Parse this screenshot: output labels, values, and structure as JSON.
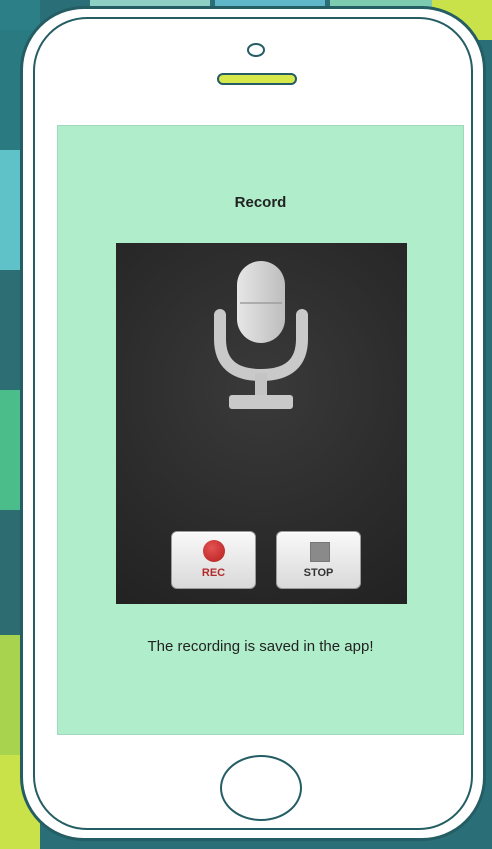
{
  "colors": {
    "screen_bg": "#b0eecb",
    "phone_outline": "#245d63",
    "rec_red": "#c02626"
  },
  "screen": {
    "title": "Record",
    "caption": "The recording is saved in the app!"
  },
  "controls": {
    "rec_label": "REC",
    "stop_label": "STOP"
  },
  "icons": {
    "mic": "microphone-icon",
    "rec": "record-dot-icon",
    "stop": "stop-square-icon",
    "home": "home-button"
  }
}
